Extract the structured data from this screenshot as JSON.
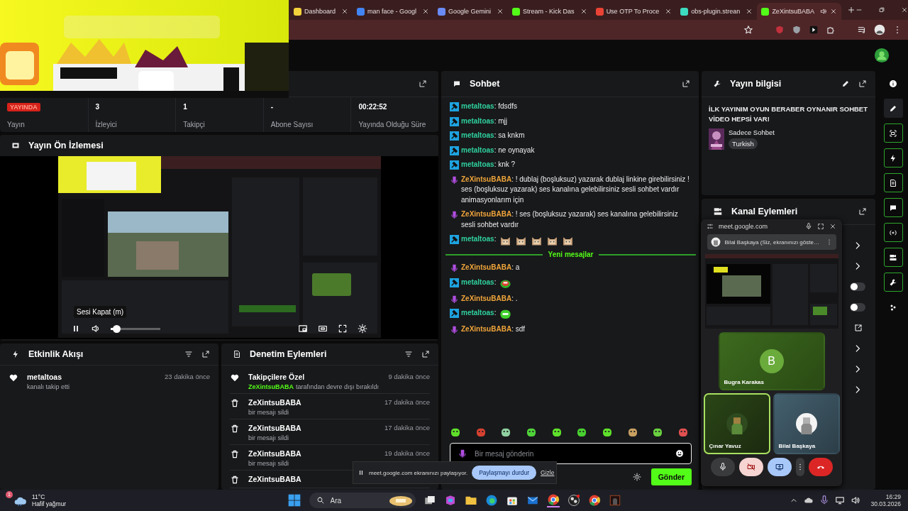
{
  "browser": {
    "tabs": [
      {
        "label": "Dashboard",
        "color": "#f3d23b",
        "selected": false,
        "audio": false
      },
      {
        "label": "man face - Googl",
        "color": "#4285f4",
        "selected": false,
        "audio": false
      },
      {
        "label": "Google Gemini",
        "color": "#6a8cf7",
        "selected": false,
        "audio": false
      },
      {
        "label": "Stream - Kick Das",
        "color": "#53fc18",
        "selected": false,
        "audio": false
      },
      {
        "label": "Use OTP To Proce",
        "color": "#ea4335",
        "selected": false,
        "audio": false
      },
      {
        "label": "obs-plugin.strean",
        "color": "#3ddbc0",
        "selected": false,
        "audio": false
      },
      {
        "label": "ZeXintsuBABA",
        "color": "#53fc18",
        "selected": true,
        "audio": true
      }
    ]
  },
  "stats": [
    {
      "kind": "badge",
      "value": "YAYINDA",
      "label": "Yayın"
    },
    {
      "kind": "value",
      "value": "3",
      "label": "İzleyici"
    },
    {
      "kind": "value",
      "value": "1",
      "label": "Takipçi"
    },
    {
      "kind": "value",
      "value": "-",
      "label": "Abone Sayısı"
    },
    {
      "kind": "value",
      "value": "00:22:52",
      "label": "Yayında Olduğu Süre"
    }
  ],
  "preview": {
    "title": "Yayın Ön İzlemesi",
    "tooltip": "Sesi Kapat (m)",
    "playing": true,
    "volume": {
      "level": 0.05
    }
  },
  "activity": {
    "title": "Etkinlik Akışı",
    "items": [
      {
        "kind": "follow",
        "user": "metaltoas",
        "text": "kanalı takip etti",
        "time": "23 dakika önce"
      }
    ]
  },
  "moderation": {
    "title": "Denetim Eylemleri",
    "items": [
      {
        "kind": "followers_only",
        "title": "Takipçilere Özel",
        "actor": "ZeXintsuBABA",
        "text": "tarafından devre dışı bırakıldı",
        "time": "9 dakika önce"
      },
      {
        "kind": "delete",
        "title": "ZeXintsuBABA",
        "text": "bir mesajı sildi",
        "time": "17 dakika önce"
      },
      {
        "kind": "delete",
        "title": "ZeXintsuBABA",
        "text": "bir mesajı sildi",
        "time": "17 dakika önce"
      },
      {
        "kind": "delete",
        "title": "ZeXintsuBABA",
        "text": "bir mesajı sildi",
        "time": "19 dakika önce"
      },
      {
        "kind": "delete",
        "title": "ZeXintsuBABA"
      }
    ]
  },
  "chat": {
    "title": "Sohbet",
    "items": [
      {
        "kind": "message",
        "badge": {
          "kind": "moderator"
        },
        "user": "metaltoas",
        "color": "#2fd19e",
        "text": ": fdsdfs"
      },
      {
        "kind": "message",
        "badge": {
          "kind": "moderator"
        },
        "user": "metaltoas",
        "color": "#2fd19e",
        "text": ": mjj"
      },
      {
        "kind": "message",
        "badge": {
          "kind": "moderator"
        },
        "user": "metaltoas",
        "color": "#2fd19e",
        "text": ": sa knkm"
      },
      {
        "kind": "message",
        "badge": {
          "kind": "moderator"
        },
        "user": "metaltoas",
        "color": "#2fd19e",
        "text": ": ne oynayak"
      },
      {
        "kind": "message",
        "badge": {
          "kind": "moderator"
        },
        "user": "metaltoas",
        "color": "#2fd19e",
        "text": ": knk ?"
      },
      {
        "kind": "message",
        "badge": {
          "kind": "broadcaster"
        },
        "user": "ZeXintsuBABA",
        "color": "#f0a53a",
        "text": ": ! dublaj (boşluksuz) yazarak dublaj linkine girebilirsiniz ! ses (boşluksuz yazarak) ses kanalına gelebilirsiniz sesli sohbet vardır animasyonlarım için"
      },
      {
        "kind": "message",
        "badge": {
          "kind": "broadcaster"
        },
        "user": "ZeXintsuBABA",
        "color": "#f0a53a",
        "text": ": ! ses (boşluksuz yazarak) ses kanalına gelebilirsiniz sesli sohbet vardır"
      },
      {
        "kind": "message",
        "badge": {
          "kind": "moderator"
        },
        "user": "metaltoas",
        "color": "#2fd19e",
        "text": ":",
        "emotes": [
          {
            "kind": "cat"
          },
          {
            "kind": "cat"
          },
          {
            "kind": "cat"
          },
          {
            "kind": "cat"
          },
          {
            "kind": "cat"
          }
        ]
      },
      {
        "kind": "divider",
        "text": "Yeni mesajlar"
      },
      {
        "kind": "message",
        "badge": {
          "kind": "broadcaster"
        },
        "user": "ZeXintsuBABA",
        "color": "#f0a53a",
        "text": ": a"
      },
      {
        "kind": "message",
        "badge": {
          "kind": "moderator"
        },
        "user": "metaltoas",
        "color": "#2fd19e",
        "text": ":",
        "emotes": [
          {
            "kind": "red-blob"
          }
        ]
      },
      {
        "kind": "message",
        "badge": {
          "kind": "broadcaster"
        },
        "user": "ZeXintsuBABA",
        "color": "#f0a53a",
        "text": ": ."
      },
      {
        "kind": "message",
        "badge": {
          "kind": "moderator"
        },
        "user": "metaltoas",
        "color": "#2fd19e",
        "text": ":",
        "emotes": [
          {
            "kind": "green-blob"
          }
        ]
      },
      {
        "kind": "message",
        "badge": {
          "kind": "broadcaster"
        },
        "user": "ZeXintsuBABA",
        "color": "#f0a53a",
        "text": ": sdf"
      }
    ],
    "input": {
      "placeholder": "Bir mesaj gönderin"
    },
    "send": "Gönder"
  },
  "stream_info": {
    "title": "Yayın bilgisi",
    "stream_title": "İLK YAYINIM OYUN BERABER OYNANIR SOHBET VİDEO HEPSİ VAR!",
    "category": "Sadece Sohbet",
    "tags": [
      "Turkish"
    ]
  },
  "channel_actions": {
    "title": "Kanal Eylemleri",
    "items": [
      {
        "kind": "link"
      },
      {
        "kind": "link"
      },
      {
        "kind": "toggle",
        "on": false
      },
      {
        "kind": "toggle",
        "on": false
      },
      {
        "kind": "external"
      },
      {
        "kind": "link"
      },
      {
        "kind": "link"
      },
      {
        "kind": "link"
      }
    ]
  },
  "rail": [
    {
      "kind": "info",
      "on": false,
      "selected": false
    },
    {
      "kind": "edit",
      "on": false,
      "selected": true
    },
    {
      "kind": "preview",
      "on": true,
      "selected": false
    },
    {
      "kind": "activity",
      "on": true,
      "selected": false
    },
    {
      "kind": "moderation",
      "on": true,
      "selected": false
    },
    {
      "kind": "chat",
      "on": true,
      "selected": false
    },
    {
      "kind": "broadcast",
      "on": true,
      "selected": false
    },
    {
      "kind": "actions",
      "on": true,
      "selected": false
    },
    {
      "kind": "info-panel",
      "on": true,
      "selected": false
    },
    {
      "kind": "more",
      "on": false,
      "selected": false
    }
  ],
  "meet": {
    "origin": "meet.google.com",
    "presenter": "Bilal Başkaya (Siz, ekranınızı göste…",
    "tiles": [
      {
        "kind": "initial",
        "name": "Bugra Karakas",
        "initial": "B",
        "speaking": false
      },
      {
        "kind": "avatar",
        "name": "Çınar Yavuz",
        "speaking": true
      },
      {
        "kind": "avatar",
        "name": "Bilal Başkaya",
        "speaking": false
      }
    ],
    "camera_on": false
  },
  "share_bar": {
    "text": "meet.google.com ekranınızı paylaşıyor.",
    "stop": "Paylaşmayı durdur",
    "hide": "Gizle"
  },
  "taskbar": {
    "weather": {
      "badge": "1",
      "temp": "11°C",
      "desc": "Hafif yağmur"
    },
    "search": {
      "placeholder": "Ara"
    },
    "time": "16:29",
    "date": "30.03.2026"
  }
}
